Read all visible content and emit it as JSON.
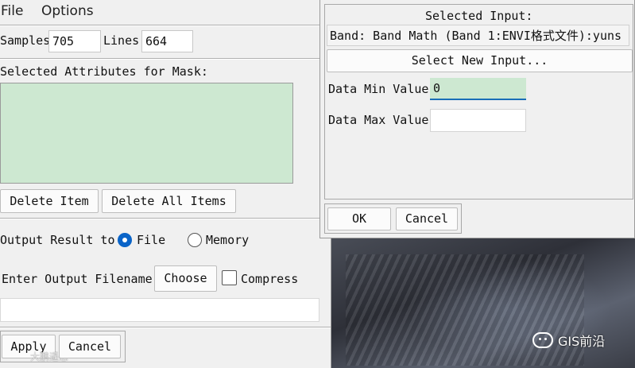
{
  "menu": {
    "file": "File",
    "options": "Options"
  },
  "samples": {
    "label": "Samples",
    "value": "705"
  },
  "lines": {
    "label": "Lines",
    "value": "664"
  },
  "attributes": {
    "label": "Selected Attributes for Mask:"
  },
  "buttons": {
    "delete_item": "Delete Item",
    "delete_all": "Delete All Items",
    "choose": "Choose",
    "apply": "Apply",
    "cancel": "Cancel"
  },
  "output": {
    "label": "Output Result to",
    "file": "File",
    "memory": "Memory",
    "selected": "File",
    "filename_label": "Enter Output Filename",
    "compress": "Compress",
    "filename_value": ""
  },
  "input_dialog": {
    "selected_input_label": "Selected Input:",
    "band_text": "Band: Band Math (Band 1:ENVI格式文件):yuns",
    "select_new": "Select New Input...",
    "min_label": "Data Min Value",
    "min_value": "0",
    "max_label": "Data Max Value",
    "max_value": "",
    "ok": "OK",
    "cancel": "Cancel"
  },
  "watermark": {
    "text": "GIS前沿",
    "apply_overlay": "大鹏遥感"
  }
}
